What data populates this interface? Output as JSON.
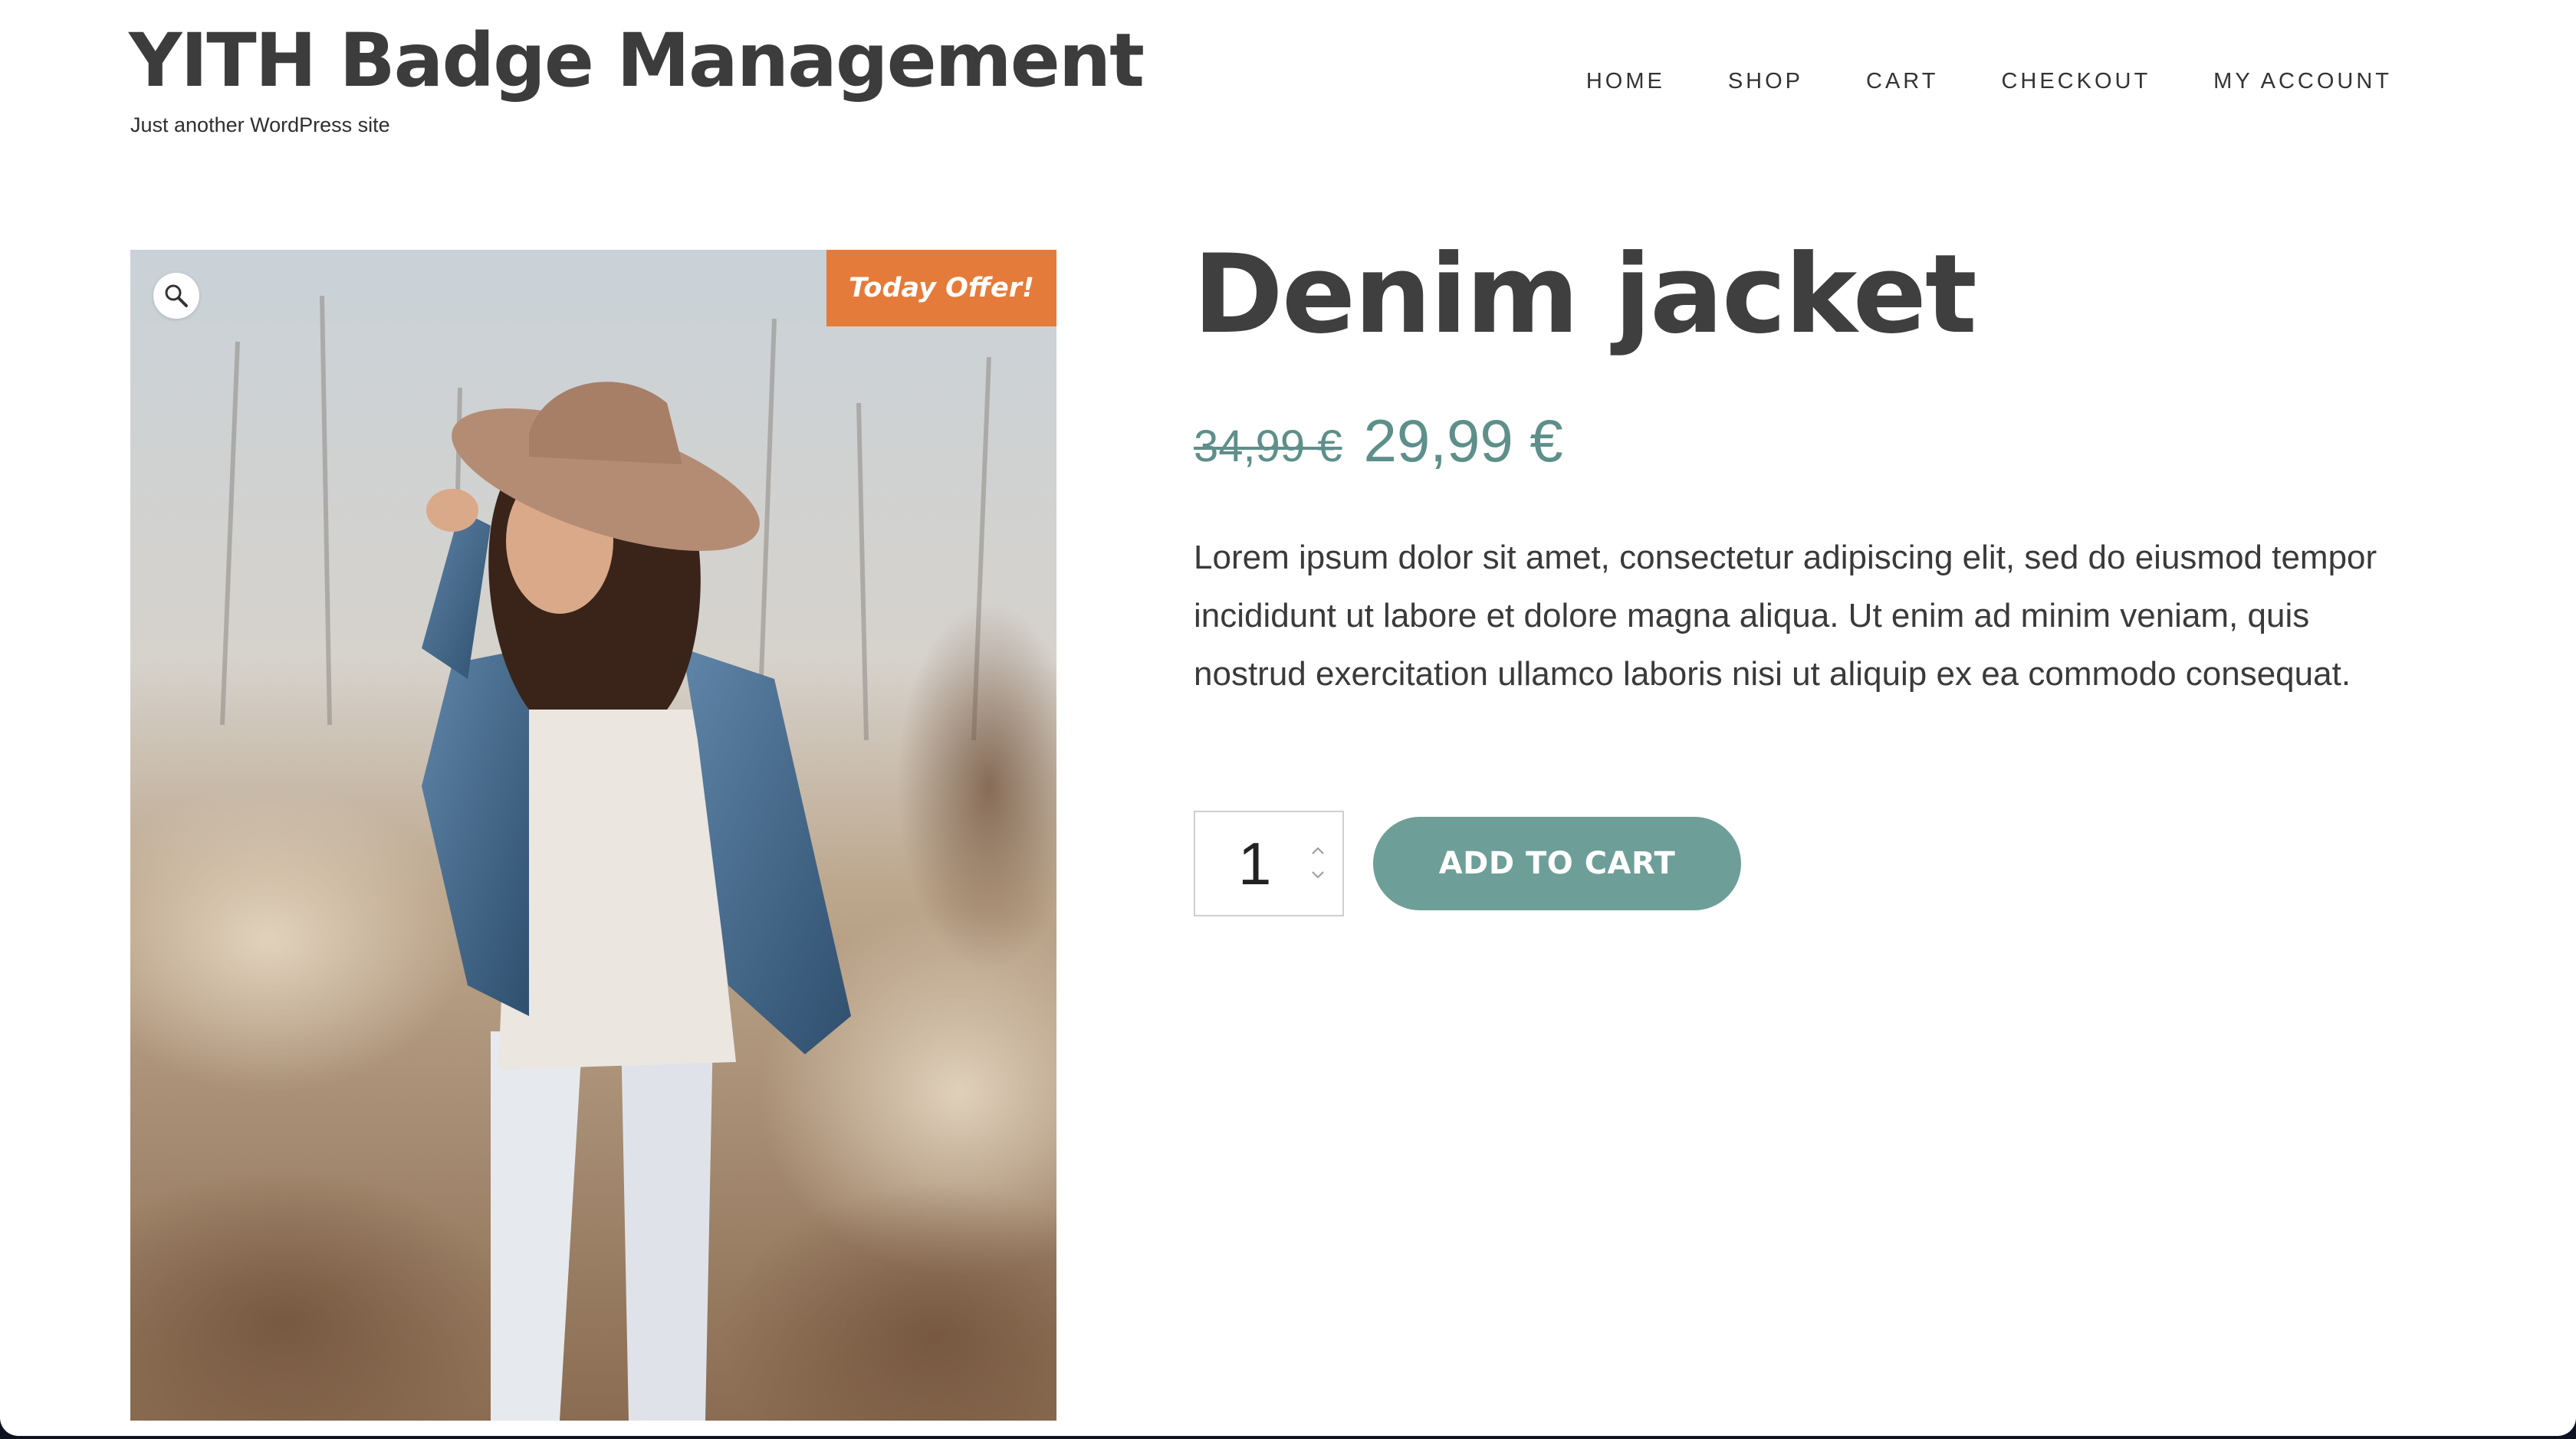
{
  "site": {
    "title": "YITH Badge Management",
    "tagline": "Just another WordPress site"
  },
  "nav": {
    "items": [
      {
        "label": "HOME"
      },
      {
        "label": "SHOP"
      },
      {
        "label": "CART"
      },
      {
        "label": "CHECKOUT"
      },
      {
        "label": "MY ACCOUNT"
      }
    ]
  },
  "product": {
    "title": "Denim jacket",
    "price_regular": "34,99 €",
    "price_sale": "29,99 €",
    "description": "Lorem ipsum dolor sit amet, consectetur adipiscing elit, sed do eiusmod tempor incididunt ut labore et dolore magna aliqua. Ut enim ad minim veniam, quis nostrud exercitation ullamco laboris nisi ut aliquip ex ea commodo consequat.",
    "badge": "Today Offer!",
    "quantity": "1",
    "add_to_cart_label": "ADD TO CART",
    "image_icon": "magnifier-icon"
  },
  "colors": {
    "accent": "#5e8f8a",
    "button": "#6e9e98",
    "badge": "#e57b3a",
    "text": "#3f3f3f"
  }
}
